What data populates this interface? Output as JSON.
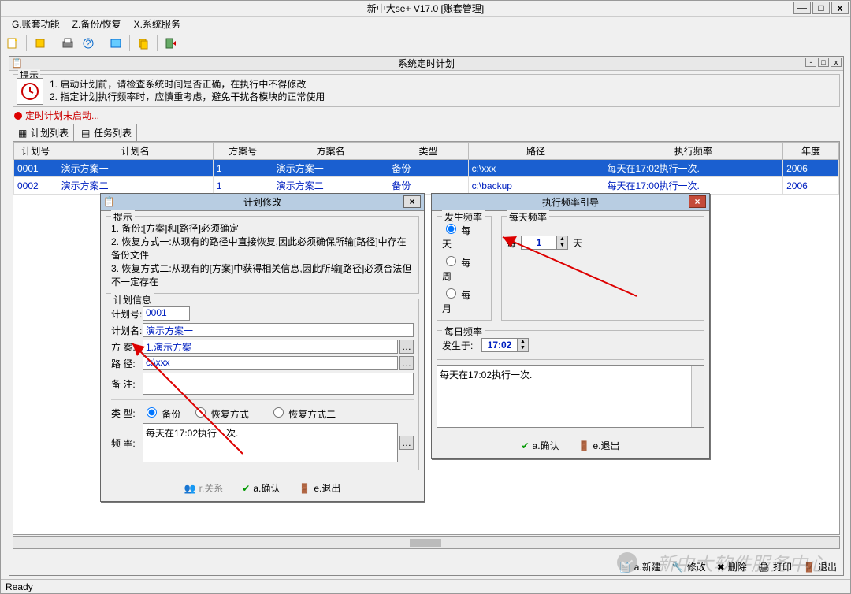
{
  "app": {
    "title": "新中大se+ V17.0 [账套管理]",
    "win_min": "—",
    "win_max": "□",
    "win_close": "x"
  },
  "menubar": {
    "m1": "G.账套功能",
    "m2": "Z.备份/恢复",
    "m3": "X.系统服务"
  },
  "embed": {
    "title": "系统定时计划",
    "tips_legend": "提示",
    "tip1": "1. 启动计划前，请检查系统时间是否正确，在执行中不得修改",
    "tip2": "2. 指定计划执行频率时，应慎重考虑，避免干扰各模块的正常使用",
    "status": "定时计划未启动...",
    "tab1": "计划列表",
    "tab2": "任务列表",
    "cols": {
      "c1": "计划号",
      "c2": "计划名",
      "c3": "方案号",
      "c4": "方案名",
      "c5": "类型",
      "c6": "路径",
      "c7": "执行频率",
      "c8": "年度"
    },
    "rows": [
      {
        "c1": "0001",
        "c2": "演示方案一",
        "c3": "1",
        "c4": "演示方案一",
        "c5": "备份",
        "c6": "c:\\xxx",
        "c7": "每天在17:02执行一次.",
        "c8": "2006"
      },
      {
        "c1": "0002",
        "c2": "演示方案二",
        "c3": "1",
        "c4": "演示方案二",
        "c5": "备份",
        "c6": "c:\\backup",
        "c7": "每天在17:00执行一次.",
        "c8": "2006"
      }
    ],
    "actions": {
      "new": "a.新建",
      "edit": "修改",
      "del": "删除",
      "print": "打印",
      "exit": "退出"
    }
  },
  "dlg_edit": {
    "title": "计划修改",
    "tips_legend": "提示",
    "t1": "1. 备份:[方案]和[路径]必须确定",
    "t2": "2. 恢复方式一:从现有的路径中直接恢复,因此必须确保所输[路径]中存在备份文件",
    "t3": "3. 恢复方式二:从现有的[方案]中获得相关信息,因此所输[路径]必须合法但不一定存在",
    "info_legend": "计划信息",
    "l_id": "计划号:",
    "v_id": "0001",
    "l_name": "计划名:",
    "v_name": "演示方案一",
    "l_scheme": "方 案:",
    "v_scheme": "1.演示方案一",
    "l_path": "路 径:",
    "v_path": "c:\\xxx",
    "l_note": "备 注:",
    "l_type": "类 型:",
    "r_backup": "备份",
    "r_rest1": "恢复方式一",
    "r_rest2": "恢复方式二",
    "l_freq": "频 率:",
    "v_freq": "每天在17:02执行一次.",
    "btn_rel": "r.关系",
    "btn_ok": "a.确认",
    "btn_exit": "e.退出"
  },
  "dlg_freq": {
    "title": "执行频率引导",
    "grp_occur": "发生频率",
    "r_day": "每天",
    "r_week": "每周",
    "r_month": "每月",
    "grp_dayfreq": "每天频率",
    "every_lbl": "每",
    "days_lbl": "天",
    "every_val": "1",
    "grp_dailyfreq": "每日频率",
    "happen_at": "发生于:",
    "time_val": "17:02",
    "summary": "每天在17:02执行一次.",
    "btn_ok": "a.确认",
    "btn_exit": "e.退出"
  },
  "statusbar": {
    "ready": "Ready"
  },
  "watermark": "新中大软件服务中心"
}
